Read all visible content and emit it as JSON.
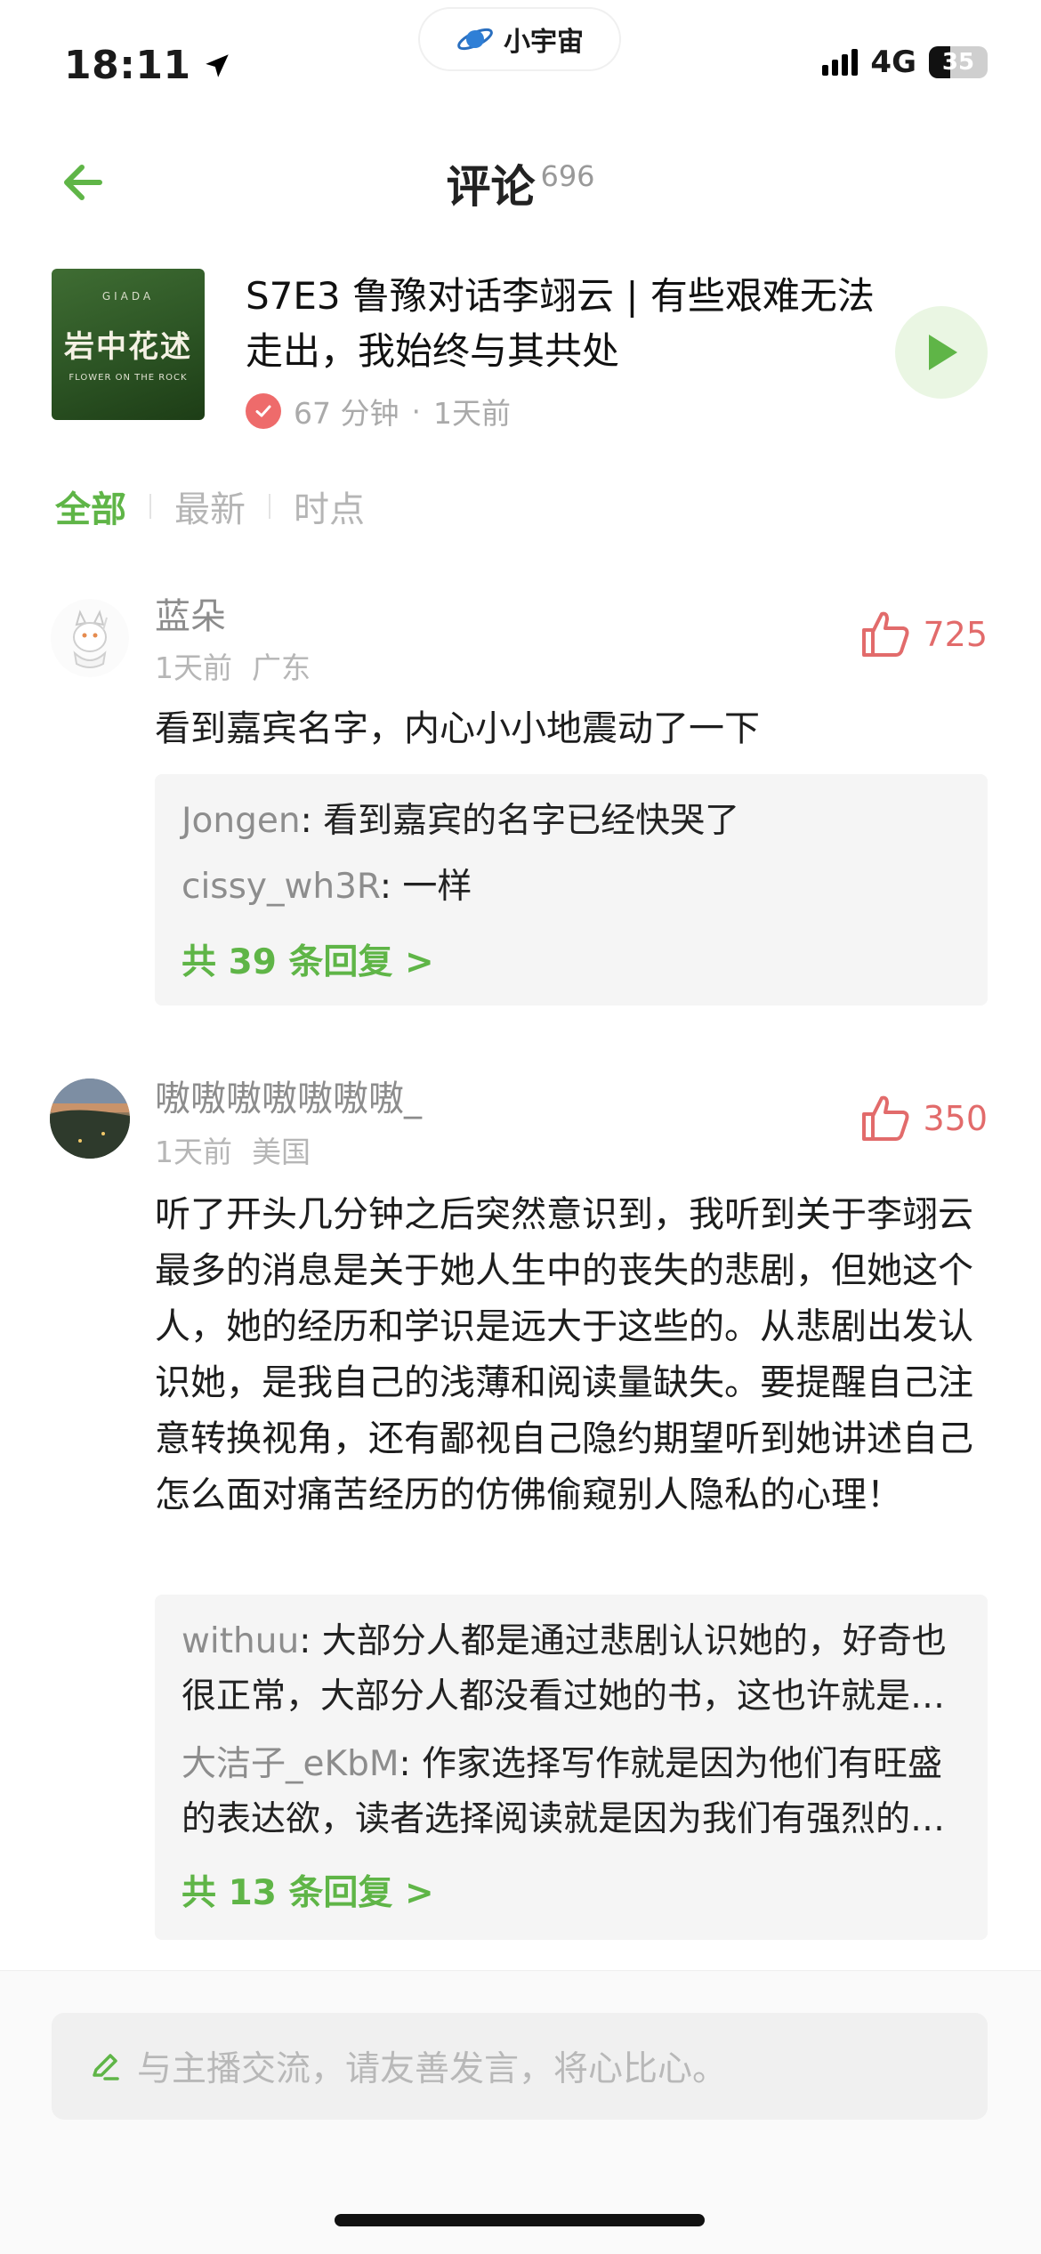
{
  "status_bar": {
    "time": "18:11",
    "app_pill": "小宇宙",
    "network": "4G",
    "battery": "35"
  },
  "header": {
    "title": "评论",
    "count": "696"
  },
  "episode": {
    "cover_brand": "GIADA",
    "cover_title": "岩中花述",
    "cover_subtitle": "FLOWER ON THE ROCK",
    "title": "S7E3 鲁豫对话李翊云 | 有些艰难无法走出，我始终与其共处",
    "duration": "67 分钟",
    "dot": "·",
    "published": "1天前"
  },
  "filters": [
    {
      "label": "全部",
      "active": true
    },
    {
      "label": "最新",
      "active": false
    },
    {
      "label": "时点",
      "active": false
    }
  ],
  "comments": [
    {
      "name": "蓝朵",
      "time": "1天前",
      "location": "广东",
      "likes": "725",
      "text": "看到嘉宾名字，内心小小地震动了一下",
      "replies": [
        {
          "name": "Jongen",
          "text": ": 看到嘉宾的名字已经快哭了"
        },
        {
          "name": "cissy_wh3R",
          "text": ": 一样"
        }
      ],
      "more": "共 39 条回复 >"
    },
    {
      "name": "嗷嗷嗷嗷嗷嗷嗷_",
      "time": "1天前",
      "location": "美国",
      "likes": "350",
      "text": "听了开头几分钟之后突然意识到，我听到关于李翊云最多的消息是关于她人生中的丧失的悲剧，但她这个人，她的经历和学识是远大于这些的。从悲剧出发认识她，是我自己的浅薄和阅读量缺失。要提醒自己注意转换视角，还有鄙视自己隐约期望听到她讲述自己怎么面对痛苦经历的仿佛偷窥别人隐私的心理！",
      "replies": [
        {
          "name": "withuu",
          "text": ": 大部分人都是通过悲剧认识她的，好奇也很正常，大部分人都没看过她的书，这也许就是他们的选择吧"
        },
        {
          "name": "大洁子_eKbM",
          "text": ": 作家选择写作就是因为他们有旺盛的表达欲，读者选择阅读就是因为我们有强烈的好奇心"
        }
      ],
      "more": "共 13 条回复 >"
    }
  ],
  "input": {
    "placeholder": "与主播交流，请友善发言，将心比心。"
  },
  "colors": {
    "accent": "#5fb547",
    "like": "#e26b6b",
    "muted": "#8c8c8c"
  }
}
